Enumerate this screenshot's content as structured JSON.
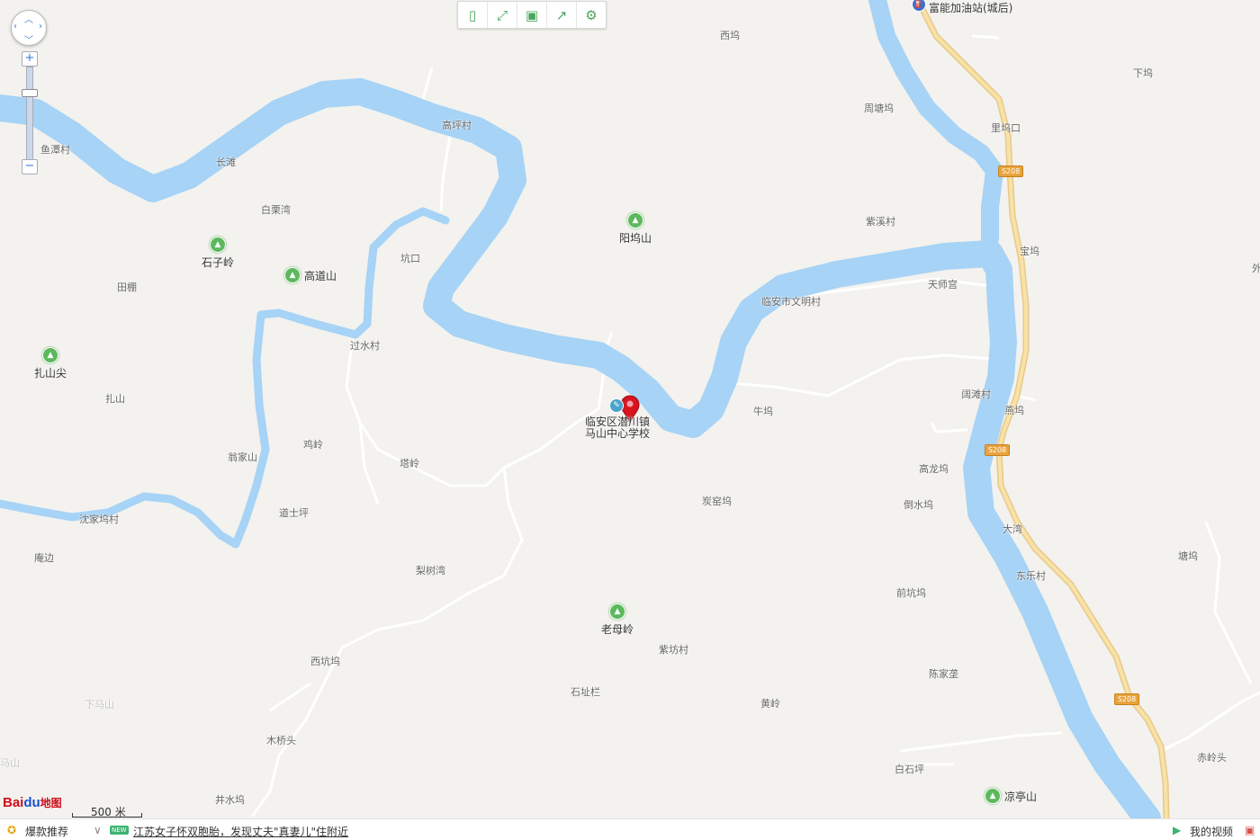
{
  "toolbar": {
    "buttons": [
      {
        "name": "fullscreen-page",
        "icon": "page-icon",
        "glyph": "▯"
      },
      {
        "name": "expand",
        "icon": "expand-icon",
        "glyph": "⤢"
      },
      {
        "name": "save",
        "icon": "save-icon",
        "glyph": "▣"
      },
      {
        "name": "share",
        "icon": "share-icon",
        "glyph": "↗"
      },
      {
        "name": "settings",
        "icon": "gear-icon",
        "glyph": "⚙"
      }
    ]
  },
  "controls": {
    "zoom_in": "+",
    "zoom_out": "−"
  },
  "poi": {
    "gas_station": "富能加油站(城后)",
    "school_line1": "临安区潜川镇",
    "school_line2": "马山中心学校"
  },
  "mountains": {
    "m1": "石子岭",
    "m2": "高道山",
    "m3": "扎山尖",
    "m4": "阳坞山",
    "m5": "老母岭",
    "m6": "凉亭山"
  },
  "labels": {
    "l1": "西坞",
    "l2": "下坞",
    "l3": "周塘坞",
    "l4": "里坞口",
    "l5": "宝坞",
    "l6": "紫溪村",
    "l7": "天师宫",
    "l8": "临安市文明村",
    "l9": "高坪村",
    "l10": "鱼潭村",
    "l11": "长滩",
    "l12": "白栗湾",
    "l13": "坑口",
    "l14": "田棚",
    "l15": "过水村",
    "l16": "扎山",
    "l17": "鸡岭",
    "l18": "翁家山",
    "l19": "塔岭",
    "l20": "道士坪",
    "l21": "沈家坞村",
    "l22": "庵边",
    "l23": "梨树湾",
    "l24": "牛坞",
    "l25": "阔滩村",
    "l26": "燕坞",
    "l27": "高龙坞",
    "l28": "炭窑坞",
    "l29": "倒水坞",
    "l30": "大湾",
    "l31": "塘坞",
    "l32": "东乐村",
    "l33": "前坑坞",
    "l34": "紫坊村",
    "l35": "西坑坞",
    "l36": "陈家垄",
    "l37": "石址栏",
    "l38": "黄岭",
    "l39": "木桥头",
    "l40": "白石坪",
    "l41": "赤岭头",
    "l42": "井水坞",
    "l43": "外",
    "l44": "下马山",
    "l45": "马山"
  },
  "roads": {
    "s208": "S208"
  },
  "scale": {
    "label": "500 米"
  },
  "logo": {
    "text1": "Bai",
    "text2": "du",
    "text3": "地图"
  },
  "bottom": {
    "recommend": "爆款推荐",
    "news": "江苏女子怀双胞胎，发现丈夫\"真妻儿\"住附近",
    "new_badge": "NEW",
    "my_video": "我的视频"
  },
  "colors": {
    "water": "#a6d3f6",
    "land": "#f3f2ee",
    "road_major": "#f7d88e",
    "park": "#5cb85c"
  }
}
